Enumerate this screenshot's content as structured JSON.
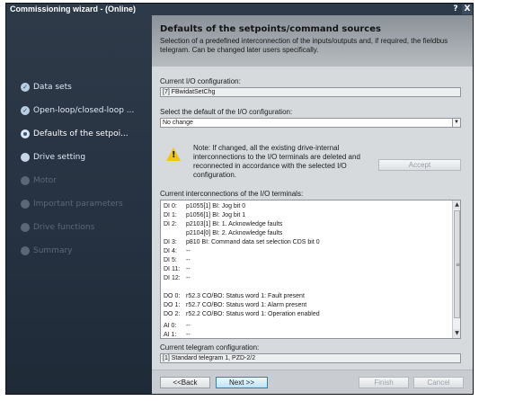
{
  "window": {
    "title": "Commissioning wizard - (Online)",
    "help_label": "?",
    "close_label": "X"
  },
  "sidebar": {
    "items": [
      {
        "label": "Data sets",
        "state": "done",
        "glyph": "✓"
      },
      {
        "label": "Open-loop/closed-loop ...",
        "state": "done",
        "glyph": "✓"
      },
      {
        "label": "Defaults of the setpoi...",
        "state": "active",
        "glyph": ""
      },
      {
        "label": "Drive setting",
        "state": "next",
        "glyph": ""
      },
      {
        "label": "Motor",
        "state": "disabled",
        "glyph": ""
      },
      {
        "label": "Important parameters",
        "state": "disabled",
        "glyph": ""
      },
      {
        "label": "Drive functions",
        "state": "disabled",
        "glyph": ""
      },
      {
        "label": "Summary",
        "state": "disabled",
        "glyph": ""
      }
    ]
  },
  "header": {
    "title": "Defaults of the setpoints/command sources",
    "description": "Selection of a predefined interconnection of the inputs/outputs and, if required, the fieldbus telegram. Can be changed later users specifically."
  },
  "current_io": {
    "label": "Current I/O configuration:",
    "value": "[7] FBwidatSetChg"
  },
  "default_io": {
    "label": "Select the default of the I/O configuration:",
    "value": "No change",
    "arrow": "▼"
  },
  "warning": {
    "text": "Note: If changed, all the existing drive-internal interconnections to the I/O terminals are deleted and reconnected in accordance with the selected I/O configuration."
  },
  "accept_button": "Accept",
  "interconnections": {
    "label": "Current interconnections of the I/O terminals:",
    "lines": [
      {
        "terminal": "DI 0:",
        "value": "p1055[1] BI: Jog bit 0"
      },
      {
        "terminal": "DI 1:",
        "value": "p1056[1] BI: Jog bit 1"
      },
      {
        "terminal": "DI 2:",
        "value": "p2103[1] BI: 1. Acknowledge faults"
      },
      {
        "terminal": "",
        "value": "p2104[0] BI: 2. Acknowledge faults"
      },
      {
        "terminal": "DI 3:",
        "value": "p810 BI: Command data set selection CDS bit 0"
      },
      {
        "terminal": "DI 4:",
        "value": "--"
      },
      {
        "terminal": "DI 5:",
        "value": "--"
      },
      {
        "terminal": "DI 11:",
        "value": "--"
      },
      {
        "terminal": "DI 12:",
        "value": "--"
      },
      {
        "terminal": "",
        "value": ""
      },
      {
        "terminal": "DO 0:",
        "value": "r52.3 CO/BO: Status word 1: Fault present"
      },
      {
        "terminal": "DO 1:",
        "value": "r52.7 CO/BO: Status word 1: Alarm present"
      },
      {
        "terminal": "DO 2:",
        "value": "r52.2 CO/BO: Status word 1: Operation enabled"
      },
      {
        "terminal": "",
        "value": ""
      },
      {
        "terminal": "AI 0:",
        "value": "--"
      },
      {
        "terminal": "AI 1:",
        "value": "--"
      }
    ],
    "scroll_up": "▲",
    "scroll_down": "▼",
    "grip": "≡"
  },
  "telegram": {
    "label": "Current telegram configuration:",
    "value": "[1] Standard telegram 1, PZD-2/2"
  },
  "buttons": {
    "back": "<<Back",
    "next": "Next >>",
    "finish": "Finish",
    "cancel": "Cancel"
  }
}
